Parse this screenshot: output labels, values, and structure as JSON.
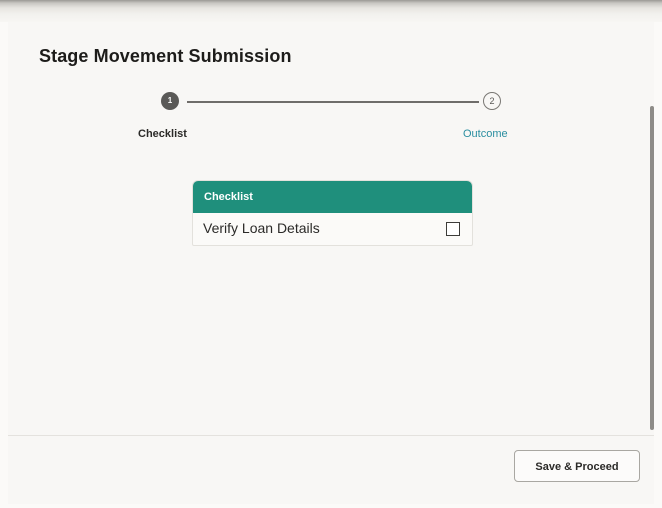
{
  "dialog": {
    "title": "Stage Movement Submission"
  },
  "train": {
    "steps": [
      {
        "number": "1",
        "label": "Checklist",
        "state": "current"
      },
      {
        "number": "2",
        "label": "Outcome",
        "state": "next"
      }
    ]
  },
  "checklist": {
    "header": "Checklist",
    "items": [
      {
        "label": "Verify Loan Details",
        "checked": false
      }
    ]
  },
  "footer": {
    "save_proceed_label": "Save & Proceed"
  },
  "colors": {
    "card_header": "#1f8f7c",
    "link_step": "#2a8ea0",
    "current_step": "#5a5957"
  },
  "icons": {
    "current_step": "step-number-icon",
    "next_step": "step-number-icon",
    "checkbox": "checkbox-icon"
  }
}
